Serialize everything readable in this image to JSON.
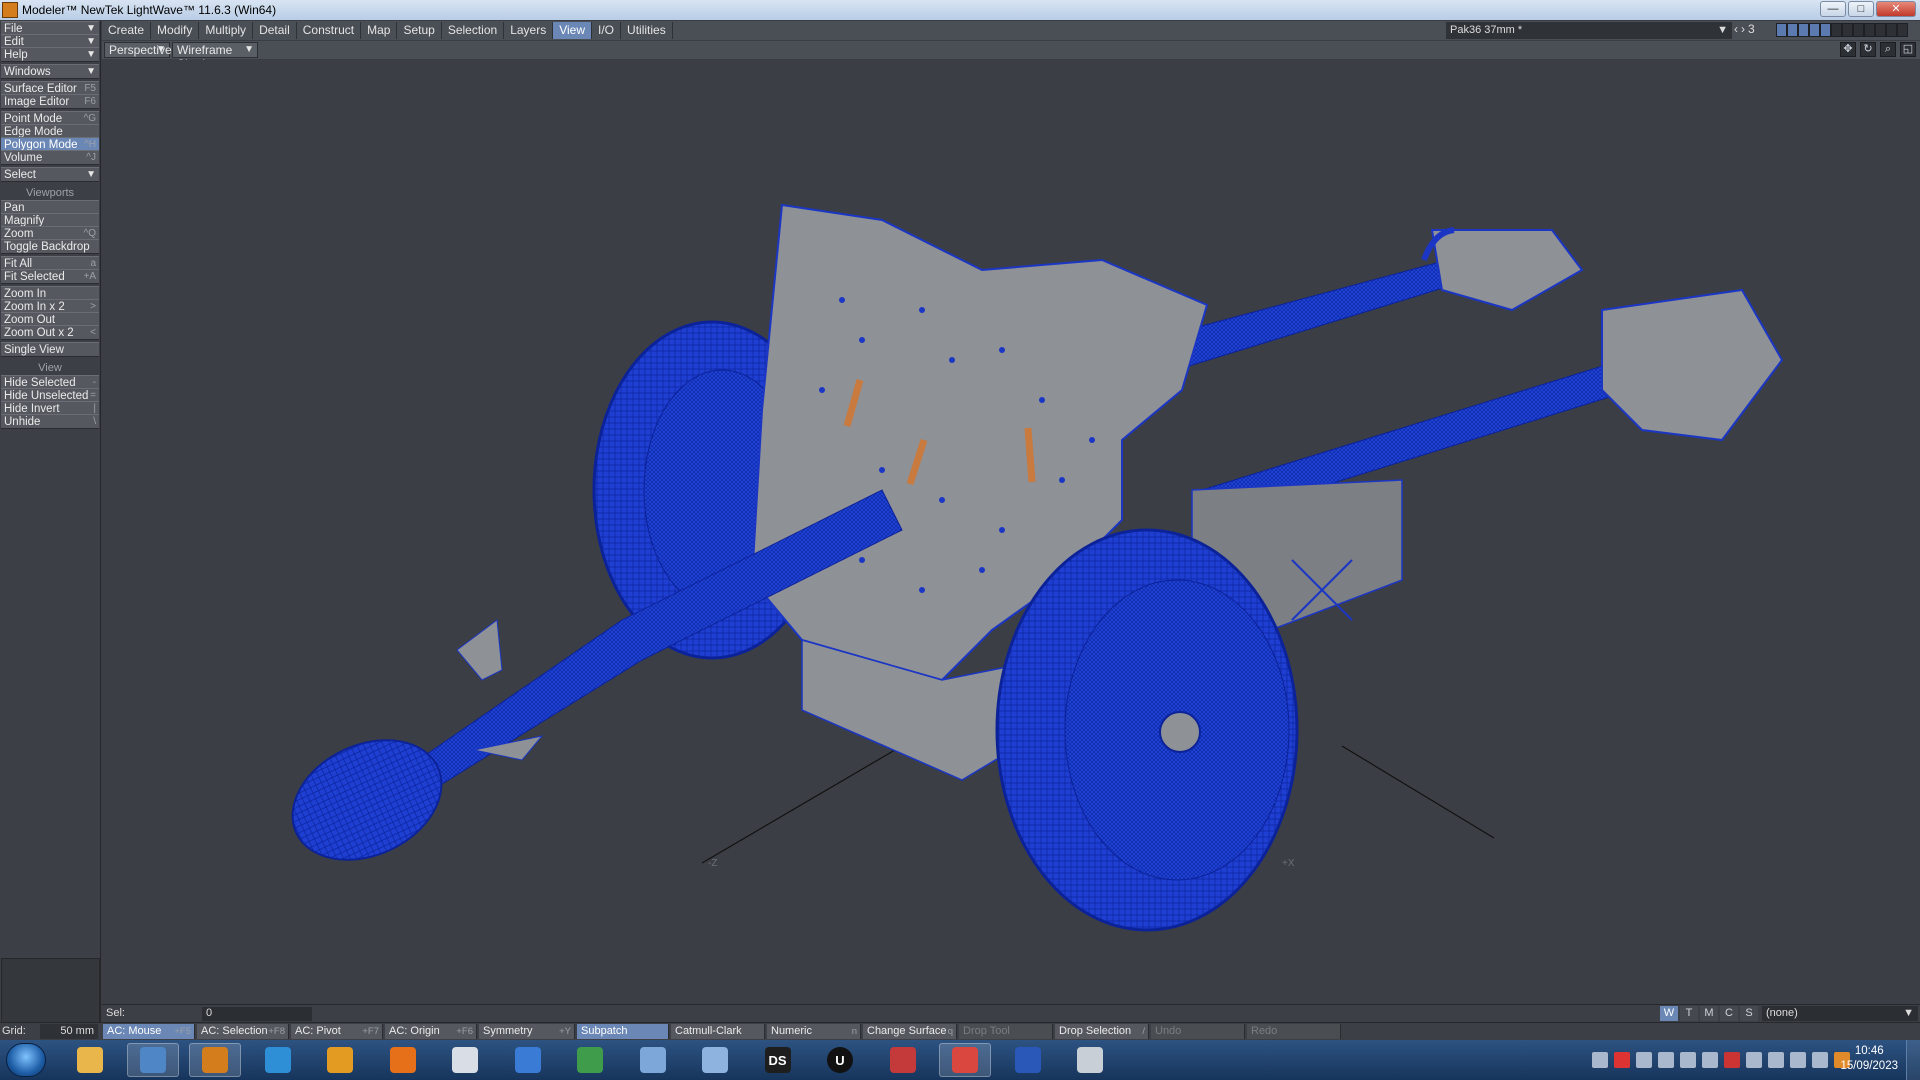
{
  "window": {
    "title": "Modeler™ NewTek LightWave™ 11.6.3 (Win64)",
    "buttons": [
      "minimize",
      "maximize",
      "close"
    ]
  },
  "menu_tabs": [
    {
      "label": "Create",
      "active": false
    },
    {
      "label": "Modify",
      "active": false
    },
    {
      "label": "Multiply",
      "active": false
    },
    {
      "label": "Detail",
      "active": false
    },
    {
      "label": "Construct",
      "active": false
    },
    {
      "label": "Map",
      "active": false
    },
    {
      "label": "Setup",
      "active": false
    },
    {
      "label": "Selection",
      "active": false
    },
    {
      "label": "Layers",
      "active": false
    },
    {
      "label": "View",
      "active": true
    },
    {
      "label": "I/O",
      "active": false
    },
    {
      "label": "Utilities",
      "active": false
    }
  ],
  "document": {
    "name": "Pak36 37mm *",
    "layer_number": "3"
  },
  "view_options": {
    "projection": "Perspective",
    "shading": "Wireframe Shade"
  },
  "toolbar": {
    "file": "File",
    "edit": "Edit",
    "help": "Help",
    "windows": "Windows",
    "surface_editor": {
      "label": "Surface Editor",
      "shortcut": "F5"
    },
    "image_editor": {
      "label": "Image Editor",
      "shortcut": "F6"
    },
    "point_mode": {
      "label": "Point Mode",
      "shortcut": "^G"
    },
    "edge_mode": {
      "label": "Edge Mode",
      "shortcut": ""
    },
    "polygon_mode": {
      "label": "Polygon Mode",
      "shortcut": "^H"
    },
    "volume": {
      "label": "Volume",
      "shortcut": "^J"
    },
    "select": "Select",
    "section_viewports": "Viewports",
    "pan": "Pan",
    "magnify": "Magnify",
    "zoom": {
      "label": "Zoom",
      "shortcut": "^Q"
    },
    "toggle_backdrop": "Toggle Backdrop",
    "fit_all": {
      "label": "Fit All",
      "shortcut": "a"
    },
    "fit_selected": {
      "label": "Fit Selected",
      "shortcut": "+A"
    },
    "zoom_in": "Zoom In",
    "zoom_in_x2": {
      "label": "Zoom In x 2",
      "shortcut": ">"
    },
    "zoom_out": "Zoom Out",
    "zoom_out_x2": {
      "label": "Zoom Out x 2",
      "shortcut": "<"
    },
    "single_view": "Single View",
    "section_view": "View",
    "hide_selected": {
      "label": "Hide Selected",
      "shortcut": "-"
    },
    "hide_unselected": {
      "label": "Hide Unselected",
      "shortcut": "="
    },
    "hide_invert": {
      "label": "Hide Invert",
      "shortcut": "|"
    },
    "unhide": {
      "label": "Unhide",
      "shortcut": "\\"
    }
  },
  "viewport": {
    "axis_labels": {
      "z": "-Z",
      "x": "+X"
    },
    "colors": {
      "background": "#3b3f45",
      "wireframe": "#1c3bd6",
      "surface": "#8e9196",
      "accent": "#6b87b5"
    }
  },
  "status": {
    "sel_label": "Sel:",
    "sel_value": "0",
    "view_tabs": [
      {
        "label": "W",
        "active": true
      },
      {
        "label": "T",
        "active": false
      },
      {
        "label": "M",
        "active": false
      },
      {
        "label": "C",
        "active": false
      },
      {
        "label": "S",
        "active": false
      }
    ],
    "map_select": "(none)"
  },
  "bottom_bar": {
    "grid_label": "Grid:",
    "grid_value": "50 mm",
    "buttons": [
      {
        "label": "AC: Mouse",
        "shortcut": "+F5",
        "active": true
      },
      {
        "label": "AC: Selection",
        "shortcut": "+F8",
        "active": false
      },
      {
        "label": "AC: Pivot",
        "shortcut": "+F7",
        "active": false
      },
      {
        "label": "AC: Origin",
        "shortcut": "+F6",
        "active": false
      },
      {
        "label": "Symmetry",
        "shortcut": "+Y",
        "active": false
      },
      {
        "label": "Subpatch",
        "shortcut": "",
        "active": true
      },
      {
        "label": "Catmull-Clark",
        "shortcut": "",
        "active": false
      },
      {
        "label": "Numeric",
        "shortcut": "n",
        "active": false
      },
      {
        "label": "Change Surface",
        "shortcut": "q",
        "active": false
      },
      {
        "label": "Drop Tool",
        "shortcut": "",
        "active": false,
        "dim": true
      },
      {
        "label": "Drop Selection",
        "shortcut": "/",
        "active": false
      },
      {
        "label": "Undo",
        "shortcut": "",
        "active": false,
        "dim": true
      },
      {
        "label": "Redo",
        "shortcut": "",
        "active": false,
        "dim": true
      }
    ]
  },
  "taskbar": {
    "apps": [
      {
        "name": "explorer-icon",
        "glyph": "",
        "color": "#e8b64a",
        "open": false
      },
      {
        "name": "image-viewer-icon",
        "glyph": "",
        "color": "#4f86c6",
        "open": true
      },
      {
        "name": "lightwave-modeler-icon",
        "glyph": "",
        "color": "#d37d1c",
        "open": true
      },
      {
        "name": "lightwave-hub-icon",
        "glyph": "",
        "color": "#2f8fd6",
        "open": false
      },
      {
        "name": "lightwave-layout-icon",
        "glyph": "",
        "color": "#e39b22",
        "open": false
      },
      {
        "name": "firefox-icon",
        "glyph": "",
        "color": "#e66f1a",
        "open": false
      },
      {
        "name": "notepad-icon",
        "glyph": "",
        "color": "#d9dee6",
        "open": false
      },
      {
        "name": "thunderbird-icon",
        "glyph": "",
        "color": "#3a7bd5",
        "open": false
      },
      {
        "name": "monitor-icon",
        "glyph": "",
        "color": "#3f9c4b",
        "open": false
      },
      {
        "name": "envelope-icon",
        "glyph": "",
        "color": "#7da7d9",
        "open": false
      },
      {
        "name": "calculator-icon",
        "glyph": "",
        "color": "#8fb3df",
        "open": false
      },
      {
        "name": "daz-studio-icon",
        "glyph": "DS",
        "color": "#1e1e1e",
        "open": false
      },
      {
        "name": "unreal-icon",
        "glyph": "U",
        "color": "#111111",
        "open": false
      },
      {
        "name": "unknown-app-icon",
        "glyph": "",
        "color": "#c43a3a",
        "open": false
      },
      {
        "name": "chrome-icon",
        "glyph": "",
        "color": "#d9473f",
        "open": true
      },
      {
        "name": "flag-app-icon",
        "glyph": "",
        "color": "#2a58b8",
        "open": false
      },
      {
        "name": "paint-icon",
        "glyph": "",
        "color": "#c9cfd6",
        "open": false
      }
    ],
    "clock": {
      "time": "10:46",
      "date": "15/09/2023"
    }
  }
}
